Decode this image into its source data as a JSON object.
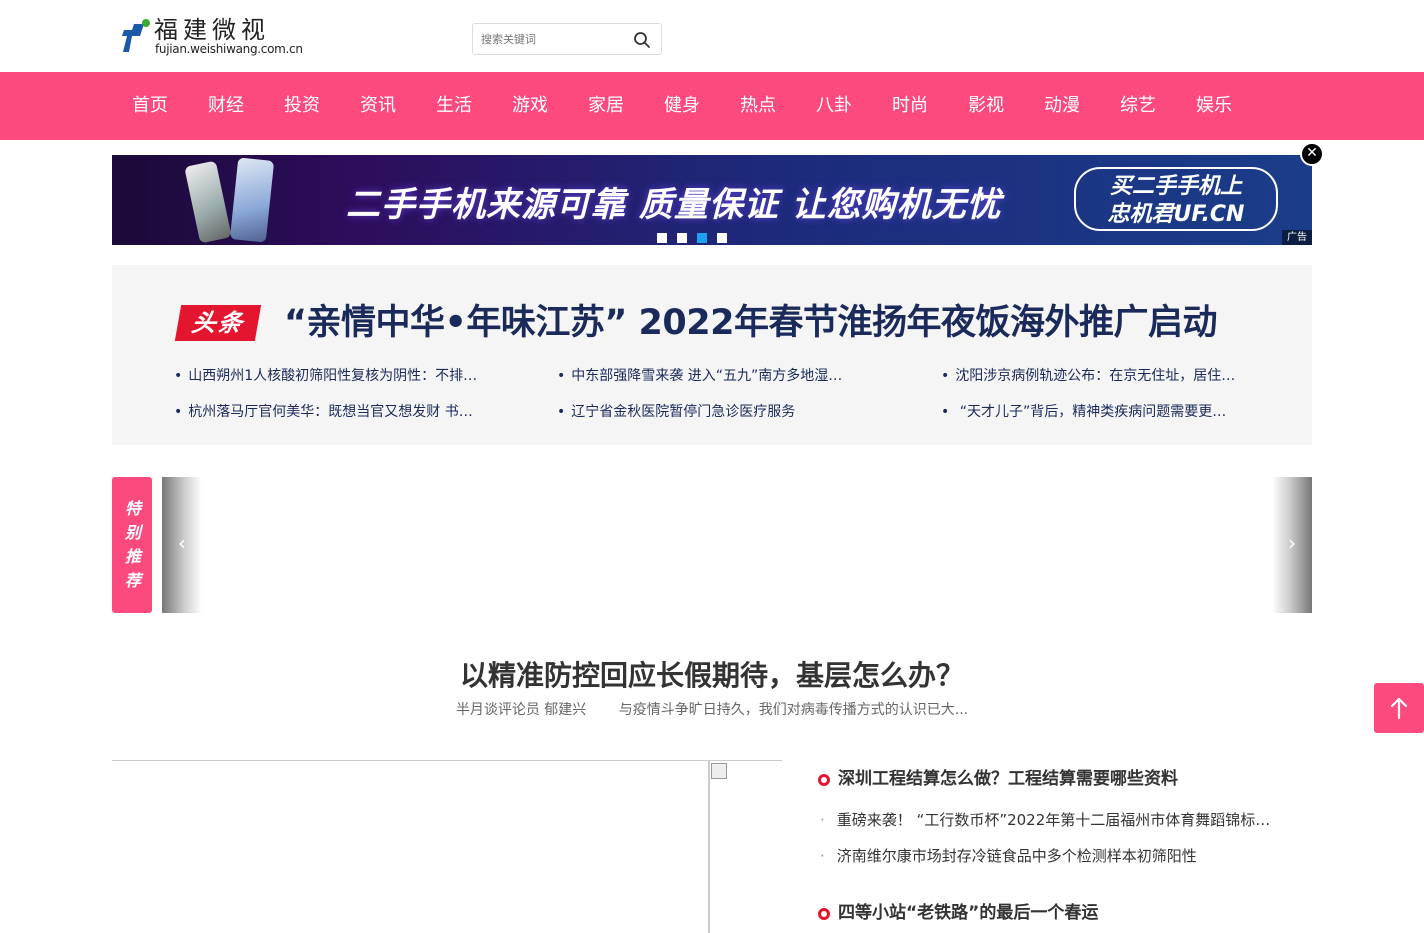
{
  "logo": {
    "cn": "福建微视",
    "en": "fujian.weishiwang.com.cn"
  },
  "search": {
    "placeholder": "搜索关键词"
  },
  "nav": [
    "首页",
    "财经",
    "投资",
    "资讯",
    "生活",
    "游戏",
    "家居",
    "健身",
    "热点",
    "八卦",
    "时尚",
    "影视",
    "动漫",
    "综艺",
    "娱乐"
  ],
  "banner": {
    "text": "二手手机来源可靠 质量保证 让您购机无忧",
    "slogan_line1": "买二手手机上",
    "slogan_line2": "忠机君UF.CN",
    "ad_label": "广告",
    "close_label": "✕",
    "dots": 4,
    "active_dot": 2
  },
  "headline": {
    "tag": "头条",
    "title": "“亲情中华•年味江苏” 2022年春节淮扬年夜饭海外推广启动",
    "links": [
      "山西朔州1人核酸初筛阳性复核为阴性：不排…",
      "中东部强降雪来袭 进入“五九”南方多地湿…",
      "沈阳涉京病例轨迹公布：在京无住址，居住…",
      "杭州落马厅官何美华：既想当官又想发财 书…",
      "辽宁省金秋医院暂停门急诊医疗服务",
      " “天才儿子”背后，精神类疾病问题需要更…"
    ]
  },
  "recommend": {
    "label_chars": [
      "特",
      "别",
      "推",
      "荐"
    ],
    "prev": "‹",
    "next": "›"
  },
  "feature": {
    "title": "以精准防控回应长假期待，基层怎么办？",
    "author": "半月谈评论员 郁建兴",
    "summary": "与疫情斗争旷日持久，我们对病毒传播方式的认识已大..."
  },
  "news": [
    {
      "title": "深圳工程结算怎么做？工程结算需要哪些资料",
      "links": [
        "重磅来袭！ “工行数币杯”2022年第十二届福州市体育舞蹈锦标…",
        "济南维尔康市场封存冷链食品中多个检测样本初筛阳性"
      ]
    },
    {
      "title": "四等小站“老铁路”的最后一个春运",
      "links": []
    }
  ],
  "colors": {
    "accent": "#fc4a7e",
    "headline_red": "#e4162f",
    "headline_navy": "#1a2a5a"
  },
  "icons": {
    "search": "search-icon",
    "back_to_top": "arrow-up-icon",
    "close": "close-icon"
  }
}
